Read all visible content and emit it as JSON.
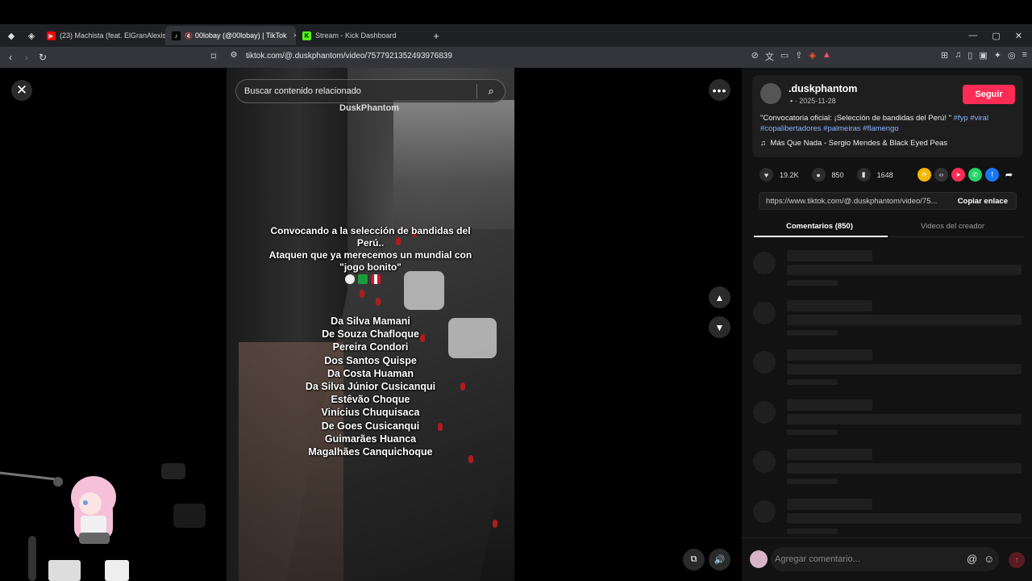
{
  "browser": {
    "tabs": [
      {
        "label": "(23) Machista (feat. ElGranAlexis) - V",
        "favicon_color": "#ff0000"
      },
      {
        "label": "00lobay (@00lobay) | TikTok",
        "favicon_color": "#000000",
        "close": "×"
      },
      {
        "label": "Stream - Kick Dashboard",
        "favicon_color": "#53fc18"
      }
    ],
    "new_tab": "+",
    "url": "tiktok.com/@.duskphantom/video/7577921352493976839",
    "window_controls": [
      "—",
      "▢",
      "✕"
    ]
  },
  "player": {
    "close": "✕",
    "search_placeholder": "Buscar contenido relacionado",
    "watermark": "DuskPhantom",
    "overlay_lines": [
      "Convocando a la selección de bandidas del",
      "Perú..",
      "Ataquen que ya merecemos un mundial con",
      "\"jogo bonito\""
    ],
    "names": [
      "Da Silva  Mamani",
      "De Souza Chafloque",
      "Pereira Condori",
      "Dos Santos Quispe",
      "Da Costa Huaman",
      "Da Silva Júnior Cusicanqui",
      "Estêvão  Choque",
      "Vinícius Chuquisaca",
      "De Goes Cusicanqui",
      "Guimarães  Huanca",
      "Magalhães Canquichoque"
    ],
    "more": "•••",
    "up": "▲",
    "down": "▼"
  },
  "author": {
    "username": ".duskphantom",
    "date": "· 2025-11-28",
    "follow_label": "Seguir",
    "description": "\"Convocatoria oficial: ¡Selección de bandidas del Perú! \"",
    "hashtags": [
      "#fyp",
      "#viral",
      "#copalibertadores",
      "#palmeiras",
      "#flamengo"
    ],
    "music": "Más Que Nada - Sergio Mendes & Black Eyed Peas"
  },
  "stats": {
    "likes": "19.2K",
    "comments": "850",
    "saves": "1648"
  },
  "share": {
    "link": "https://www.tiktok.com/@.duskphantom/video/75...",
    "copy_label": "Copiar enlace"
  },
  "panel_tabs": {
    "comments": "Comentarios (850)",
    "creator_videos": "Videos del creador"
  },
  "comment_input": {
    "placeholder": "Agregar comentario..."
  },
  "colors": {
    "accent": "#fe2c55",
    "panel_bg": "#121212",
    "hashtag": "#8ab4ff"
  }
}
